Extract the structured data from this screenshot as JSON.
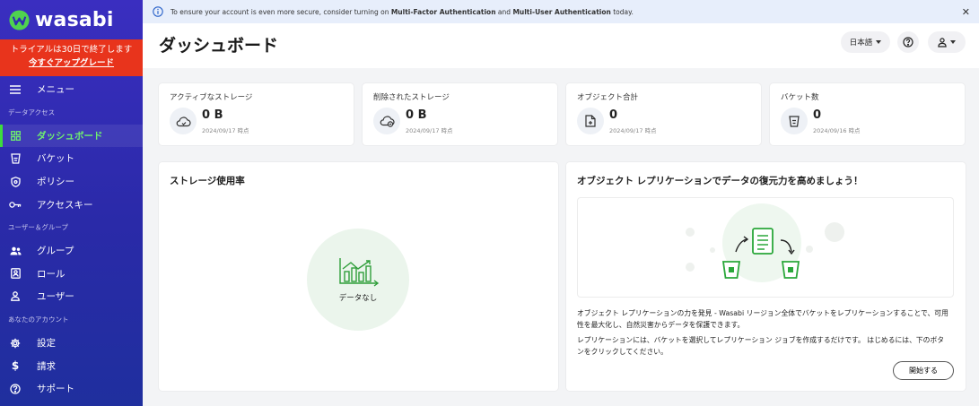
{
  "brand": {
    "name": "wasabi"
  },
  "trial": {
    "text": "トライアルは30日で終了します",
    "link": "今すぐアップグレード"
  },
  "sidebar": {
    "menu_label": "メニュー",
    "sections": {
      "data_access": "データアクセス",
      "users_groups": "ユーザー＆グループ",
      "your_account": "あなたのアカウント"
    },
    "items": {
      "dashboard": "ダッシュボード",
      "buckets": "バケット",
      "policies": "ポリシー",
      "access_keys": "アクセスキー",
      "groups": "グループ",
      "roles": "ロール",
      "users": "ユーザー",
      "settings": "設定",
      "billing": "請求",
      "support": "サポート"
    },
    "active": "dashboard"
  },
  "banner": {
    "prefix": "To ensure your account is even more secure, consider turning on",
    "mfa": "Multi-Factor Authentication",
    "and": "and",
    "mua": "Multi-User Authentication",
    "suffix": "today."
  },
  "header": {
    "title": "ダッシュボード",
    "language": "日本語"
  },
  "stats": [
    {
      "label": "アクティブなストレージ",
      "value": "0 B",
      "date": "2024/09/17 時点",
      "icon": "cloud-sync-icon"
    },
    {
      "label": "削除されたストレージ",
      "value": "0 B",
      "date": "2024/09/17 時点",
      "icon": "cloud-delete-icon"
    },
    {
      "label": "オブジェクト合計",
      "value": "0",
      "date": "2024/09/17 時点",
      "icon": "file-add-icon"
    },
    {
      "label": "バケット数",
      "value": "0",
      "date": "2024/09/16 時点",
      "icon": "bucket-icon"
    }
  ],
  "usage": {
    "title": "ストレージ使用率",
    "empty": "データなし"
  },
  "replication": {
    "title": "オブジェクト レプリケーションでデータの復元力を高めましょう！",
    "desc1_line1": "オブジェクト レプリケーションの力を発見 - Wasabi リージョン全体でバケットをレプリケーションすることで、可用",
    "desc1_line2": "性を最大化し、自然災害からデータを保護できます。",
    "desc2_line1": "レプリケーションには、バケットを選択してレプリケーション ジョブを作成するだけです。 はじめるには、下のボタ",
    "desc2_line2": "ンをクリックしてください。",
    "button": "開始する"
  },
  "colors": {
    "sidebar": "#2f2cb4",
    "trial": "#e8341c",
    "accent_green": "#3ddc3d",
    "banner": "#e7eefb"
  }
}
